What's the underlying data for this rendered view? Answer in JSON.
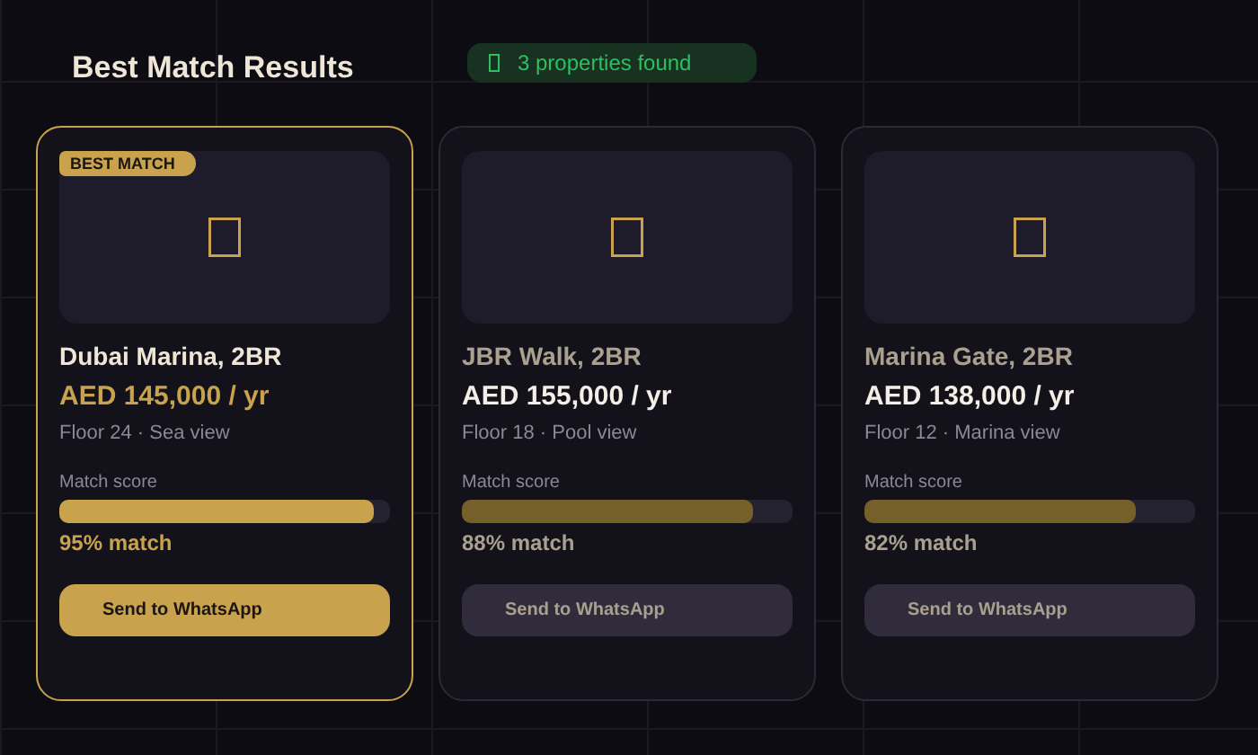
{
  "title": "Best Match Results",
  "status": {
    "text": "3 properties found"
  },
  "cards": [
    {
      "selected": true,
      "badge": "BEST MATCH",
      "name": "Dubai Marina, 2BR",
      "price": "AED 145,000 / yr",
      "details": "Floor 24 · Sea view",
      "score_label": "Match score",
      "level": 0.95,
      "reading": "95% match",
      "button": "Send to WhatsApp"
    },
    {
      "selected": false,
      "name": "JBR Walk, 2BR",
      "price": "AED 155,000 / yr",
      "details": "Floor 18 · Pool view",
      "score_label": "Match score",
      "level": 0.88,
      "reading": "88% match",
      "button": "Send to WhatsApp"
    },
    {
      "selected": false,
      "name": "Marina Gate, 2BR",
      "price": "AED 138,000 / yr",
      "details": "Floor 12 · Marina view",
      "score_label": "Match score",
      "level": 0.82,
      "reading": "82% match",
      "button": "Send to WhatsApp"
    }
  ]
}
